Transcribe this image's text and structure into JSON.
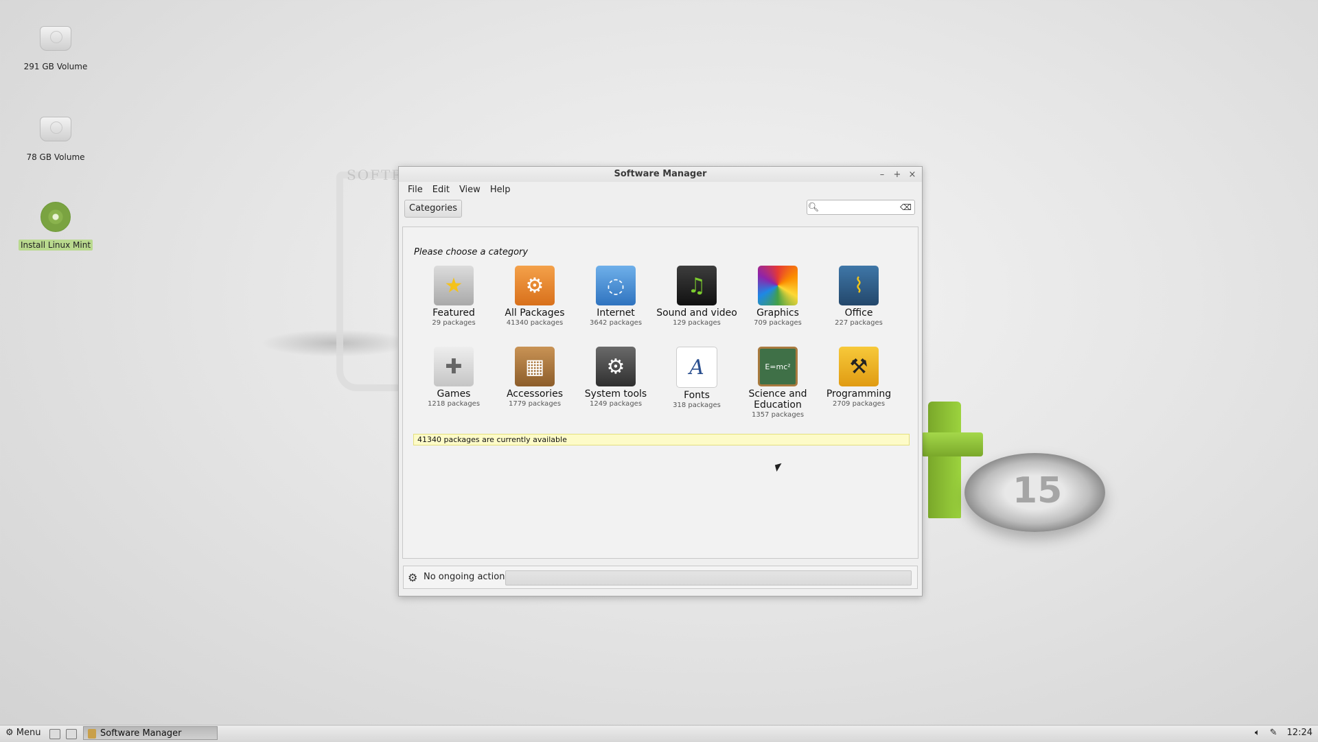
{
  "desktop": {
    "icons": [
      {
        "label": "291 GB Volume"
      },
      {
        "label": "78 GB Volume"
      },
      {
        "label": "Install Linux Mint"
      }
    ],
    "watermark": "SOFTPEDIA",
    "logo_number": "15"
  },
  "window": {
    "title": "Software Manager",
    "controls": {
      "minimize": "–",
      "maximize": "+",
      "close": "×"
    },
    "menu": [
      "File",
      "Edit",
      "View",
      "Help"
    ],
    "toolbar": {
      "categories_label": "Categories",
      "search_value": ""
    },
    "heading": "Please choose a category",
    "categories": [
      {
        "name": "Featured",
        "count": "29 packages",
        "icon": "star-icon",
        "color": "#b9b9b9"
      },
      {
        "name": "All Packages",
        "count": "41340 packages",
        "icon": "gears-icon",
        "color": "#e8872b"
      },
      {
        "name": "Internet",
        "count": "3642 packages",
        "icon": "globe-icon",
        "color": "#3d86cf"
      },
      {
        "name": "Sound and video",
        "count": "129 packages",
        "icon": "clapper-icon",
        "color": "#2b2b2b"
      },
      {
        "name": "Graphics",
        "count": "709 packages",
        "icon": "color-wheel-icon",
        "color": "#c6439d"
      },
      {
        "name": "Office",
        "count": "227 packages",
        "icon": "chart-icon",
        "color": "#2f5e86"
      },
      {
        "name": "Games",
        "count": "1218 packages",
        "icon": "gamepad-icon",
        "color": "#cfcfcf"
      },
      {
        "name": "Accessories",
        "count": "1779 packages",
        "icon": "calculator-icon",
        "color": "#a8743a"
      },
      {
        "name": "System tools",
        "count": "1249 packages",
        "icon": "gear-icon",
        "color": "#4a4a4a"
      },
      {
        "name": "Fonts",
        "count": "318 packages",
        "icon": "font-icon",
        "color": "#ffffff"
      },
      {
        "name": "Science and Education",
        "count": "1357 packages",
        "icon": "blackboard-icon",
        "color": "#3f7047"
      },
      {
        "name": "Programming",
        "count": "2709 packages",
        "icon": "construction-icon",
        "color": "#f0b71e"
      }
    ],
    "available_text": "41340 packages are currently available",
    "status": "No ongoing actions"
  },
  "taskbar": {
    "menu_label": "Menu",
    "task_label": "Software Manager",
    "clock": "12:24"
  }
}
